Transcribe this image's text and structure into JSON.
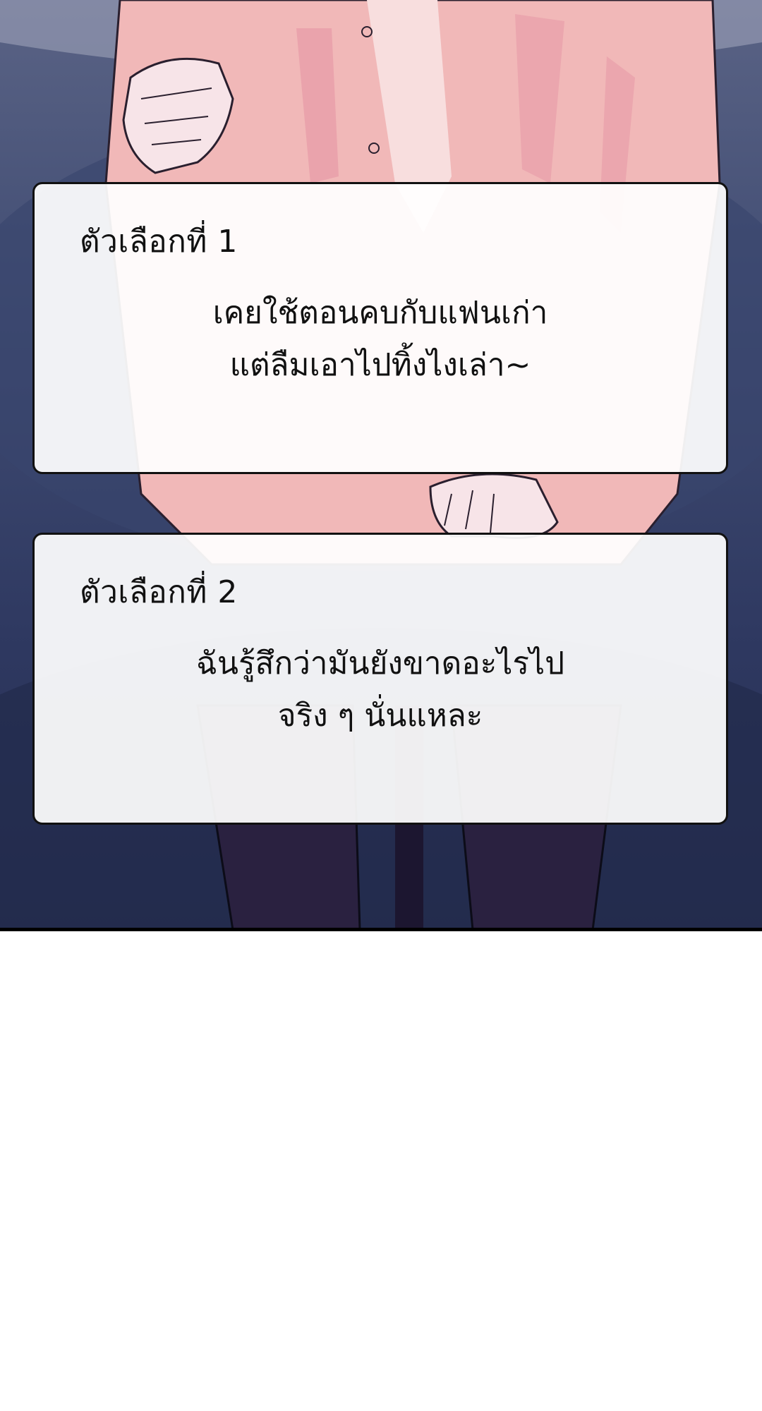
{
  "scene": {
    "description_colors": {
      "background_top": "#5a6385",
      "background_bottom": "#252e52",
      "shirt": "#f1b8b8",
      "skin": "#f7e4e8",
      "pants": "#2a2140"
    }
  },
  "choices": [
    {
      "label": "ตัวเลือกที่ 1",
      "lines": [
        "เคยใช้ตอนคบกับแฟนเก่า",
        "แต่ลืมเอาไปทิ้งไงเล่า~"
      ]
    },
    {
      "label": "ตัวเลือกที่ 2",
      "lines": [
        "ฉันรู้สึกว่ามันยังขาดอะไรไป",
        "จริง ๆ นั่นแหละ"
      ]
    }
  ]
}
